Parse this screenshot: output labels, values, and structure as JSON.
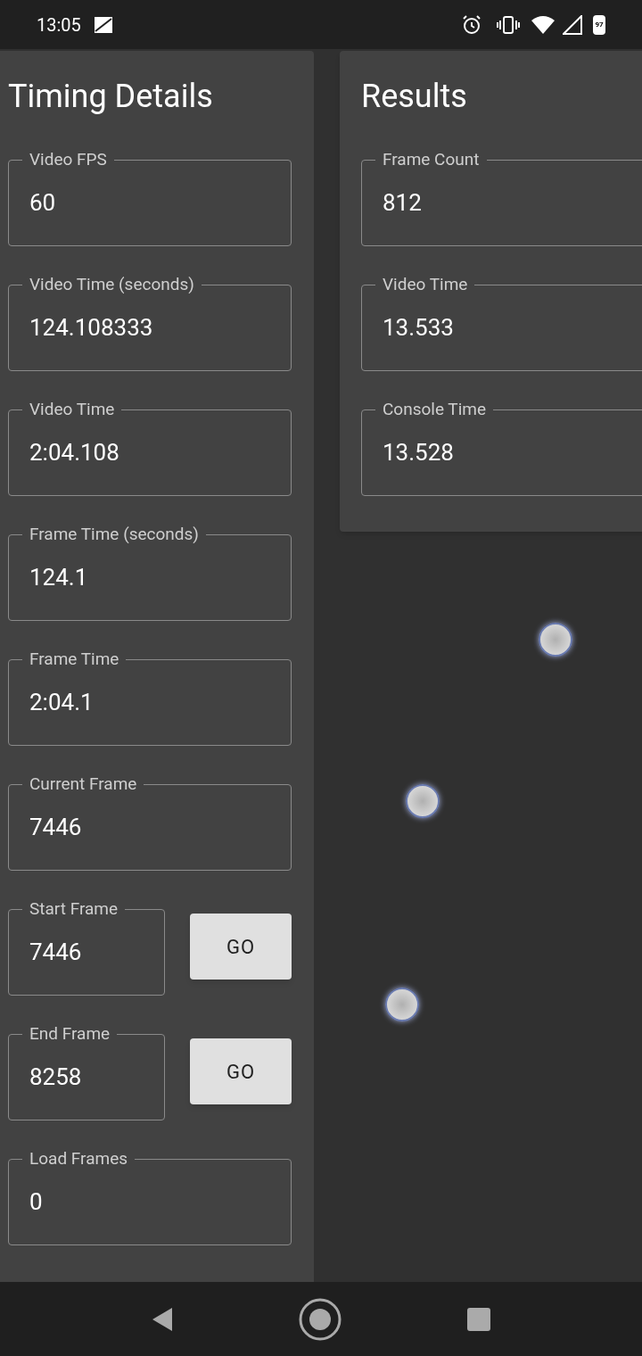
{
  "status_bar": {
    "time": "13:05",
    "battery": "97"
  },
  "timing_details": {
    "title": "Timing Details",
    "fields": [
      {
        "kind": "field",
        "label": "Video FPS",
        "value": "60"
      },
      {
        "kind": "field",
        "label": "Video Time (seconds)",
        "value": "124.108333"
      },
      {
        "kind": "field",
        "label": "Video Time",
        "value": "2:04.108"
      },
      {
        "kind": "field",
        "label": "Frame Time (seconds)",
        "value": "124.1"
      },
      {
        "kind": "field",
        "label": "Frame Time",
        "value": "2:04.1"
      },
      {
        "kind": "field",
        "label": "Current Frame",
        "value": "7446"
      },
      {
        "kind": "field_with_button",
        "label": "Start Frame",
        "value": "7446",
        "button": "GO"
      },
      {
        "kind": "field_with_button",
        "label": "End Frame",
        "value": "8258",
        "button": "GO"
      },
      {
        "kind": "field",
        "label": "Load Frames",
        "value": "0"
      }
    ]
  },
  "results": {
    "title": "Results",
    "fields": [
      {
        "kind": "field",
        "label": "Frame Count",
        "value": "812"
      },
      {
        "kind": "field",
        "label": "Video Time",
        "value": "13.533"
      },
      {
        "kind": "field",
        "label": "Console Time",
        "value": "13.528"
      }
    ]
  }
}
